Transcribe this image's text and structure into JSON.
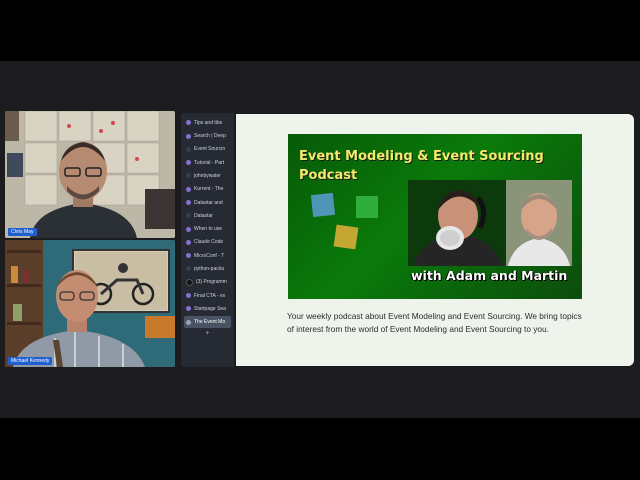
{
  "participants": [
    {
      "name": "Chris May"
    },
    {
      "name": "Michael Kennedy"
    }
  ],
  "browser": {
    "tabs": [
      {
        "label": "Tips and tibs",
        "icon": "purple-dot",
        "active": false
      },
      {
        "label": "Search | Deep",
        "icon": "purple-dot",
        "active": false
      },
      {
        "label": "Event Sourcin",
        "icon": "none",
        "active": false
      },
      {
        "label": "Tutorial - Part",
        "icon": "purple-dot",
        "active": false
      },
      {
        "label": "johnbywater",
        "icon": "none",
        "active": false
      },
      {
        "label": "Kurrent - The",
        "icon": "purple-dot",
        "active": false
      },
      {
        "label": "Datastar and",
        "icon": "purple-dot",
        "active": false
      },
      {
        "label": "Datastar",
        "icon": "dark-dot",
        "active": false
      },
      {
        "label": "When to use",
        "icon": "purple-dot",
        "active": false
      },
      {
        "label": "Claude Code",
        "icon": "purple-dot",
        "active": false
      },
      {
        "label": "MicroConf - T",
        "icon": "purple-dot",
        "active": false
      },
      {
        "label": "python-packa",
        "icon": "none",
        "active": false
      },
      {
        "label": "(3) Programm",
        "icon": "x-logo",
        "active": false
      },
      {
        "label": "Final CTA - ex",
        "icon": "purple-dot",
        "active": false
      },
      {
        "label": "Startpage Sea",
        "icon": "purple-dot",
        "active": false
      },
      {
        "label": "The Event Mo",
        "icon": "shield",
        "active": true
      }
    ],
    "new_tab_label": "+"
  },
  "page": {
    "banner": {
      "title": "Event Modeling & Event Sourcing Podcast",
      "subtitle": "with Adam and Martin"
    },
    "description": "Your weekly podcast about Event Modeling and Event Sourcing. We bring topics of interest from the world of Event Modeling and Event Sourcing to you."
  },
  "colors": {
    "banner_green": "#0a7a0a",
    "banner_title": "#f3e96a",
    "name_tag": "#1f5fd0",
    "sticky_notes": [
      "#4f95b5",
      "#2fae3c",
      "#c4a632"
    ]
  }
}
